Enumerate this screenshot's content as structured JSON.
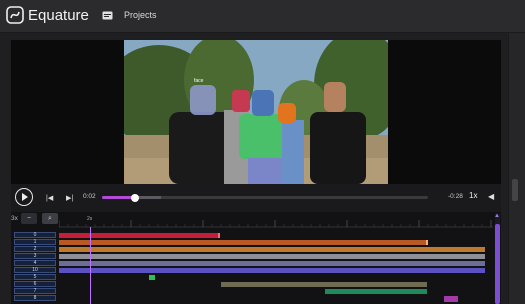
{
  "app": {
    "name": "Equature",
    "nav_projects": "Projects"
  },
  "player": {
    "current_time": "0:02",
    "remaining_time": "-0:28",
    "speed": "1x",
    "progress_fraction": 0.102,
    "buffered_fraction": 0.18
  },
  "timeline": {
    "zoom_level": "3x",
    "ruler_marker": "2s",
    "track_labels": [
      "0",
      "1",
      "2",
      "3",
      "4",
      "10",
      "5",
      "6",
      "7",
      "8"
    ],
    "accent_color": "#b44bd8"
  },
  "video": {
    "face_label": "face"
  }
}
